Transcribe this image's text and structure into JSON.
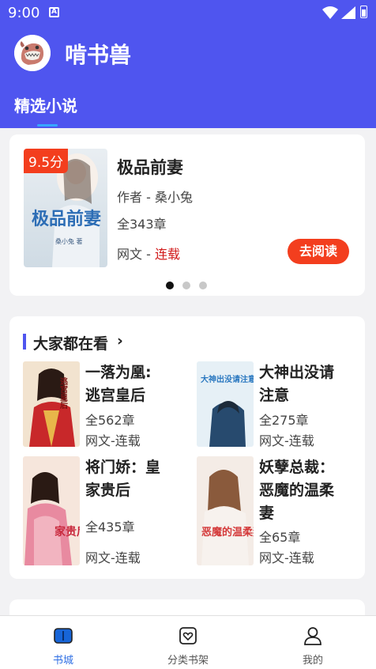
{
  "status_bar": {
    "time": "9:00",
    "app_icon": "A"
  },
  "app": {
    "title": "啃书兽",
    "tab_label": "精选小说"
  },
  "featured": {
    "rating": "9.5分",
    "title": "极品前妻",
    "author": "作者 - 桑小兔",
    "chapters": "全343章",
    "genre": "网文 - ",
    "status": "连载",
    "read_button": "去阅读",
    "cover_text": "极品前妻",
    "cover_subtext": "桑小兔 著",
    "carousel": {
      "count": 3,
      "active": 0
    }
  },
  "popular": {
    "heading": "大家都在看",
    "chevron": "›",
    "books": [
      {
        "title_lines": [
          "一落为凰:",
          "逃宫皇后"
        ],
        "chapters": "全562章",
        "genre": "网文-连载",
        "cover_text": "逃宫皇后"
      },
      {
        "title_lines": [
          "大神出没请",
          "注意"
        ],
        "chapters": "全275章",
        "genre": "网文-连载",
        "cover_text": "大神出没请注意"
      },
      {
        "title_lines": [
          "将门娇：皇",
          "家贵后"
        ],
        "chapters": "全435章",
        "genre": "网文-连载",
        "cover_text": "家贵后"
      },
      {
        "title_lines": [
          "妖孽总裁：",
          "恶魔的温柔",
          "妻"
        ],
        "chapters": "全65章",
        "genre": "网文-连载",
        "cover_text": "恶魔的温柔妻"
      }
    ]
  },
  "bottom_nav": [
    {
      "label": "书城",
      "icon": "bookstore-icon",
      "active": true
    },
    {
      "label": "分类书架",
      "icon": "bookshelf-icon",
      "active": false
    },
    {
      "label": "我的",
      "icon": "profile-icon",
      "active": false
    }
  ],
  "colors": {
    "primary": "#4f55ef",
    "accent": "#f33e1e",
    "nav_active": "#2f6fe4"
  }
}
